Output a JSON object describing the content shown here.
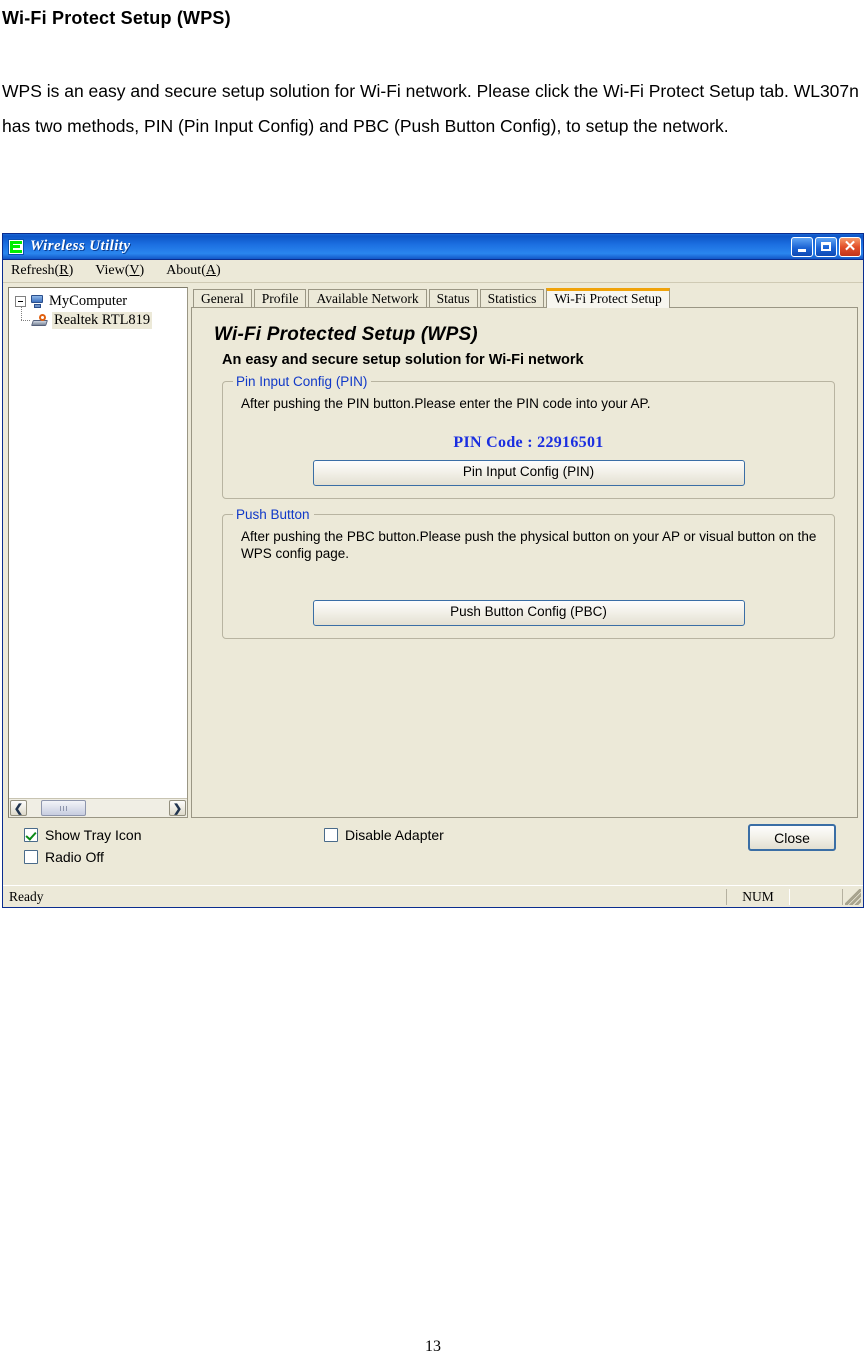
{
  "document": {
    "heading": "Wi-Fi Protect Setup (WPS)",
    "paragraph": "WPS is an easy and secure setup solution for Wi-Fi network. Please click the Wi-Fi Protect Setup tab. WL307n has two methods, PIN (Pin Input Config) and PBC (Push Button Config), to setup the network.",
    "page_number": "13"
  },
  "window": {
    "title": "Wireless Utility",
    "controls": {
      "minimize": "_",
      "maximize": "□",
      "close": "✕"
    },
    "menu": [
      {
        "label": "Refresh",
        "accel": "R"
      },
      {
        "label": "View",
        "accel": "V"
      },
      {
        "label": "About",
        "accel": "A"
      }
    ]
  },
  "tree": {
    "root": "MyComputer",
    "child": "Realtek RTL819"
  },
  "tabs": [
    {
      "label": "General",
      "active": false
    },
    {
      "label": "Profile",
      "active": false
    },
    {
      "label": "Available Network",
      "active": false
    },
    {
      "label": "Status",
      "active": false
    },
    {
      "label": "Statistics",
      "active": false
    },
    {
      "label": "Wi-Fi Protect Setup",
      "active": true
    }
  ],
  "wps": {
    "title": "Wi-Fi Protected Setup (WPS)",
    "subtitle": "An easy and secure setup solution for Wi-Fi network",
    "pin_group": {
      "legend": "Pin Input Config (PIN)",
      "description": "After pushing the PIN button.Please enter the PIN code into your AP.",
      "pin_label": "PIN Code :",
      "pin_value": "22916501",
      "pin_code_line": "PIN Code :  22916501",
      "button": "Pin Input Config (PIN)"
    },
    "pbc_group": {
      "legend": "Push Button",
      "description": "After pushing the PBC button.Please push the physical button on your AP or visual button on the WPS config page.",
      "button": "Push Button Config (PBC)"
    }
  },
  "bottom": {
    "show_tray_icon": {
      "label": "Show Tray Icon",
      "checked": true
    },
    "radio_off": {
      "label": "Radio Off",
      "checked": false
    },
    "disable_adapter": {
      "label": "Disable Adapter",
      "checked": false
    },
    "close_button": "Close"
  },
  "statusbar": {
    "message": "Ready",
    "num": "NUM"
  },
  "colors": {
    "title_bar": "#1b6ee0",
    "window_face": "#ece9d8",
    "accent_orange": "#f0a30a",
    "link_blue": "#1139c8",
    "pin_blue": "#1a2ee0",
    "button_border": "#3a6ea5",
    "check_green": "#0a8a16"
  }
}
